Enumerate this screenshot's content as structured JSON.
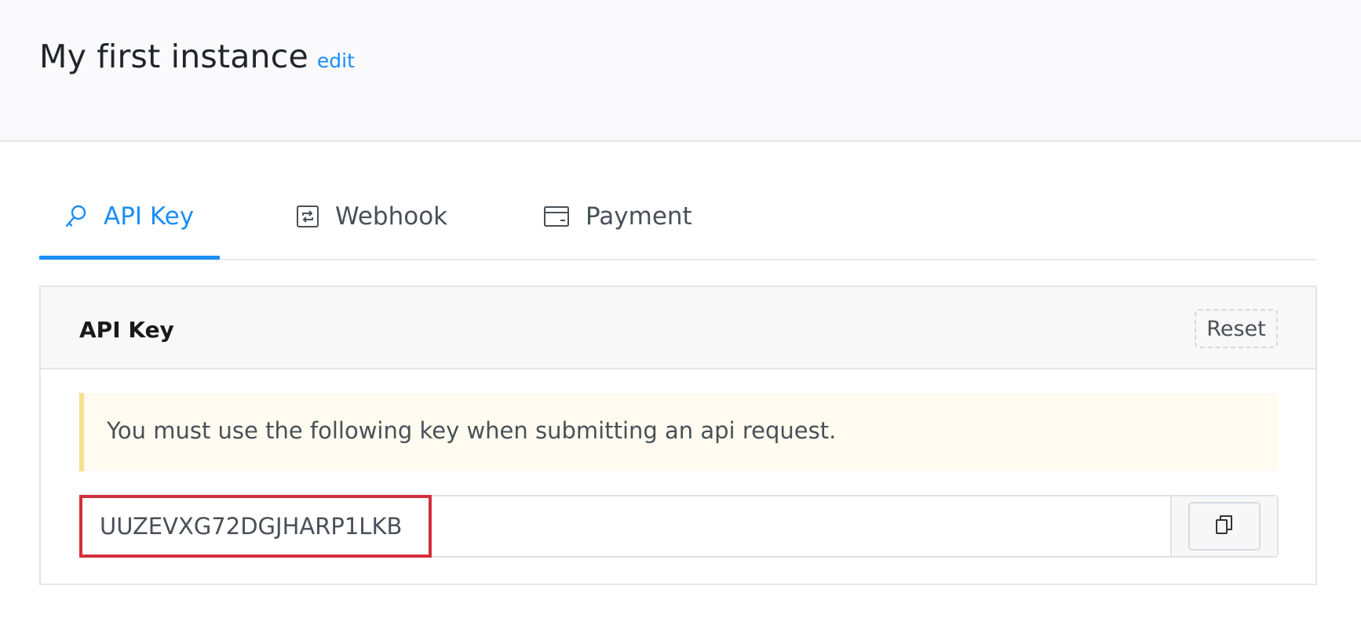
{
  "header": {
    "title": "My first instance",
    "edit_label": "edit"
  },
  "tabs": [
    {
      "label": "API Key",
      "icon": "key-icon",
      "active": true
    },
    {
      "label": "Webhook",
      "icon": "refresh-square-icon",
      "active": false
    },
    {
      "label": "Payment",
      "icon": "credit-card-icon",
      "active": false
    }
  ],
  "card": {
    "title": "API Key",
    "reset_label": "Reset",
    "notice": "You must use the following key when submitting an api request.",
    "api_key": "UUZEVXG72DGJHARP1LKB",
    "copy_icon": "copy-icon"
  },
  "colors": {
    "accent": "#1b8ef5",
    "highlight": "#d32f3a",
    "alert_border": "#f8e08e",
    "alert_bg": "#fffbf0"
  }
}
